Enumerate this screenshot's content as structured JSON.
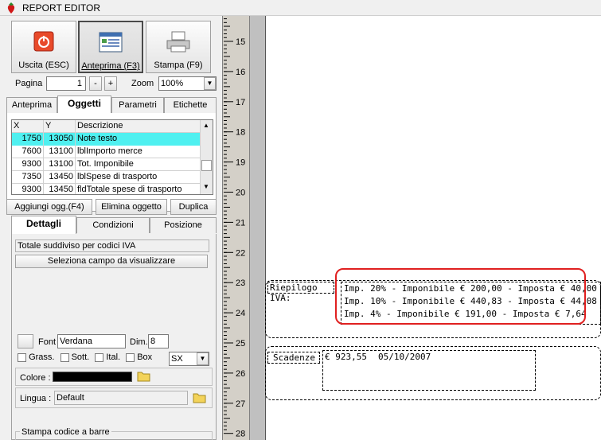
{
  "window": {
    "title": "REPORT EDITOR"
  },
  "toolbar": {
    "exit_label": "Uscita (ESC)",
    "preview_label": "Anteprima (F3)",
    "print_label": "Stampa (F9)"
  },
  "pager": {
    "page_label": "Pagina",
    "page_value": "1",
    "minus_label": "-",
    "plus_label": "+",
    "zoom_label": "Zoom",
    "zoom_value": "100%"
  },
  "tabs": [
    "Anteprima",
    "Oggetti",
    "Parametri",
    "Etichette"
  ],
  "objects": {
    "headers": [
      "X",
      "Y",
      "Descrizione"
    ],
    "rows": [
      {
        "x": "1750",
        "y": "13050",
        "desc": "Note testo"
      },
      {
        "x": "7600",
        "y": "13100",
        "desc": "lblImporto merce"
      },
      {
        "x": "9300",
        "y": "13100",
        "desc": "Tot. Imponibile"
      },
      {
        "x": "7350",
        "y": "13450",
        "desc": "lblSpese di trasporto"
      },
      {
        "x": "9300",
        "y": "13450",
        "desc": "fldTotale spese di trasporto"
      }
    ],
    "add_label": "Aggiungi ogg.(F4)",
    "delete_label": "Elimina oggetto",
    "duplicate_label": "Duplica"
  },
  "detail_tabs": [
    "Dettagli",
    "Condizioni",
    "Posizione"
  ],
  "details": {
    "field_value": "Totale suddiviso per codici IVA",
    "select_field_label": "Seleziona campo da visualizzare",
    "font_label": "Font",
    "font_value": "Verdana",
    "dim_label": "Dim.",
    "dim_value": "8",
    "bold_label": "Grass.",
    "underline_label": "Sott.",
    "italic_label": "Ital.",
    "box_label": "Box",
    "align_value": "SX",
    "color_label": "Colore :",
    "color": "#000000",
    "language_label": "Lingua :",
    "language_value": "Default",
    "barcode_label": "Stampa codice a barre"
  },
  "ruler": {
    "marks": [
      "15",
      "16",
      "17",
      "18",
      "19",
      "20",
      "21",
      "22",
      "23",
      "24",
      "25",
      "26",
      "27",
      "28"
    ]
  },
  "report": {
    "vat_summary_label": "Riepilogo IVA:",
    "vat_lines": [
      "Imp. 20% - Imponibile € 200,00 - Imposta € 40,00",
      "Imp. 10% - Imponibile € 440,83 - Imposta € 44,08",
      "Imp. 4% - Imponibile € 191,00 - Imposta € 7,64"
    ],
    "deadlines_label": "Scadenze",
    "deadline_amount": "€ 923,55",
    "deadline_date": "05/10/2007",
    "highlight_color": "#e02020"
  }
}
